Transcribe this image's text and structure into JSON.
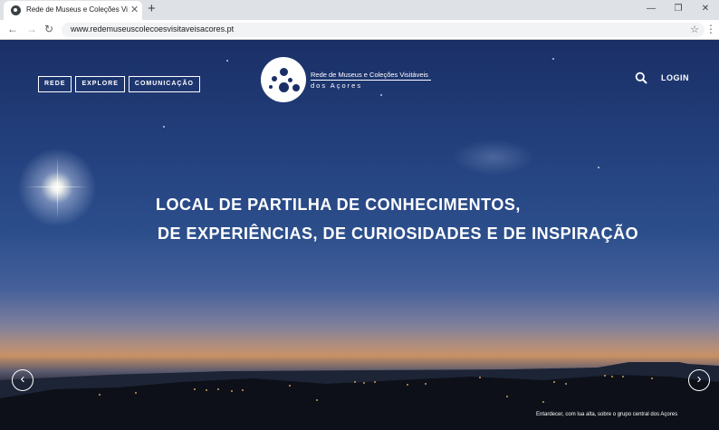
{
  "browser": {
    "tab_title": "Rede de Museus e Coleções Visitáveis",
    "tab_close": "✕",
    "new_tab": "+",
    "url": "www.redemuseuscolecoesvisitaveisacores.pt",
    "window_controls": {
      "minimize": "—",
      "restore": "❐",
      "close": "✕"
    },
    "nav": {
      "back": "←",
      "forward": "→",
      "reload": "↻"
    },
    "bookmark_icon": "star-icon",
    "menu_icon": "⋮"
  },
  "site": {
    "nav_items": [
      "REDE",
      "EXPLORE",
      "COMUNICAÇÃO"
    ],
    "logo": {
      "title": "Rede de Museus e Coleções Visitáveis",
      "subtitle": "dos Açores"
    },
    "login": "LOGIN",
    "search_icon": "search-icon",
    "headline": {
      "line1": "LOCAL DE PARTILHA DE CONHECIMENTOS,",
      "line2": "DE EXPERIÊNCIAS, DE CURIOSIDADES E DE INSPIRAÇÃO"
    },
    "carousel": {
      "prev": "‹",
      "next": "›"
    },
    "caption": "Entardecer, com lua alta, sobre o grupo central dos Açores"
  },
  "colors": {
    "sky_top": "#1a2f66",
    "sky_horizon": "#c99065",
    "text": "#ffffff"
  }
}
